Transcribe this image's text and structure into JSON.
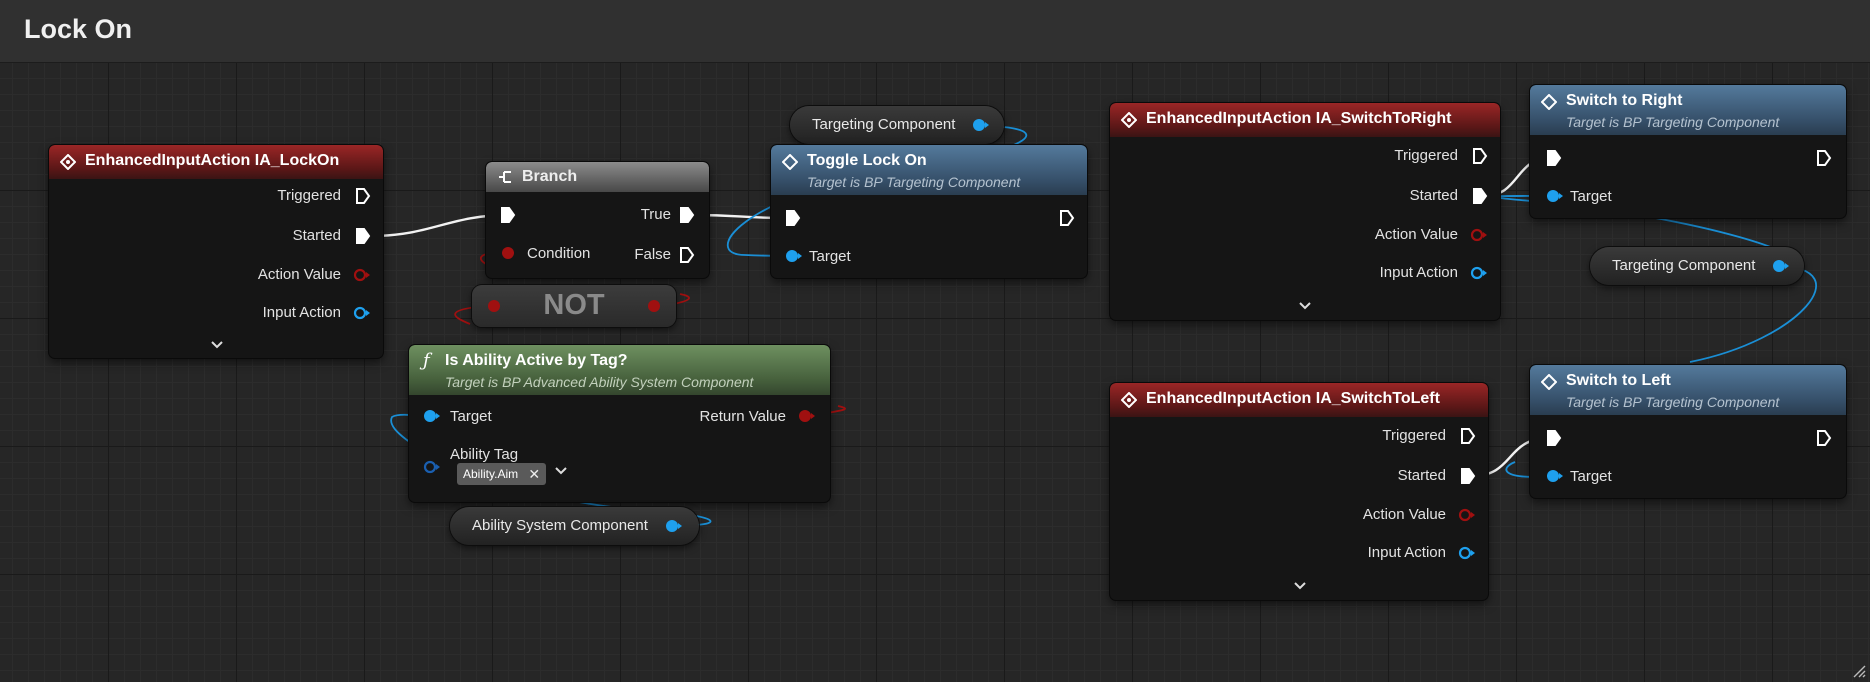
{
  "graph": {
    "title": "Lock On"
  },
  "nodes": {
    "ia_lockon": {
      "title": "EnhancedInputAction IA_LockOn",
      "pins": {
        "triggered": "Triggered",
        "started": "Started",
        "action_value": "Action Value",
        "input_action": "Input Action"
      }
    },
    "branch": {
      "title": "Branch",
      "pins": {
        "condition": "Condition",
        "true": "True",
        "false": "False"
      }
    },
    "not": {
      "title": "NOT"
    },
    "toggle": {
      "title": "Toggle Lock On",
      "subtitle": "Target is BP Targeting Component",
      "pins": {
        "target": "Target"
      }
    },
    "ability_tag_check": {
      "title": "Is Ability Active by Tag?",
      "subtitle": "Target is BP Advanced Ability System Component",
      "pins": {
        "target": "Target",
        "return_value": "Return Value",
        "ability_tag": "Ability Tag"
      },
      "tag_value": "Ability.Aim",
      "tag_clear": "✕"
    },
    "ia_switch_right": {
      "title": "EnhancedInputAction IA_SwitchToRight",
      "pins": {
        "triggered": "Triggered",
        "started": "Started",
        "action_value": "Action Value",
        "input_action": "Input Action"
      }
    },
    "switch_right": {
      "title": "Switch to Right",
      "subtitle": "Target is BP Targeting Component",
      "pins": {
        "target": "Target"
      }
    },
    "ia_switch_left": {
      "title": "EnhancedInputAction IA_SwitchToLeft",
      "pins": {
        "triggered": "Triggered",
        "started": "Started",
        "action_value": "Action Value",
        "input_action": "Input Action"
      }
    },
    "switch_left": {
      "title": "Switch to Left",
      "subtitle": "Target is BP Targeting Component",
      "pins": {
        "target": "Target"
      }
    }
  },
  "variables": {
    "targeting_component_1": "Targeting Component",
    "targeting_component_2": "Targeting Component",
    "ability_system_component": "Ability System Component"
  },
  "colors": {
    "exec": "#ffffff",
    "object_pin": "#1ea0ee",
    "bool_pin": "#a01010",
    "event_header": "#8b2222",
    "function_header": "#3e5b78",
    "pure_header": "#5b7a4e"
  }
}
